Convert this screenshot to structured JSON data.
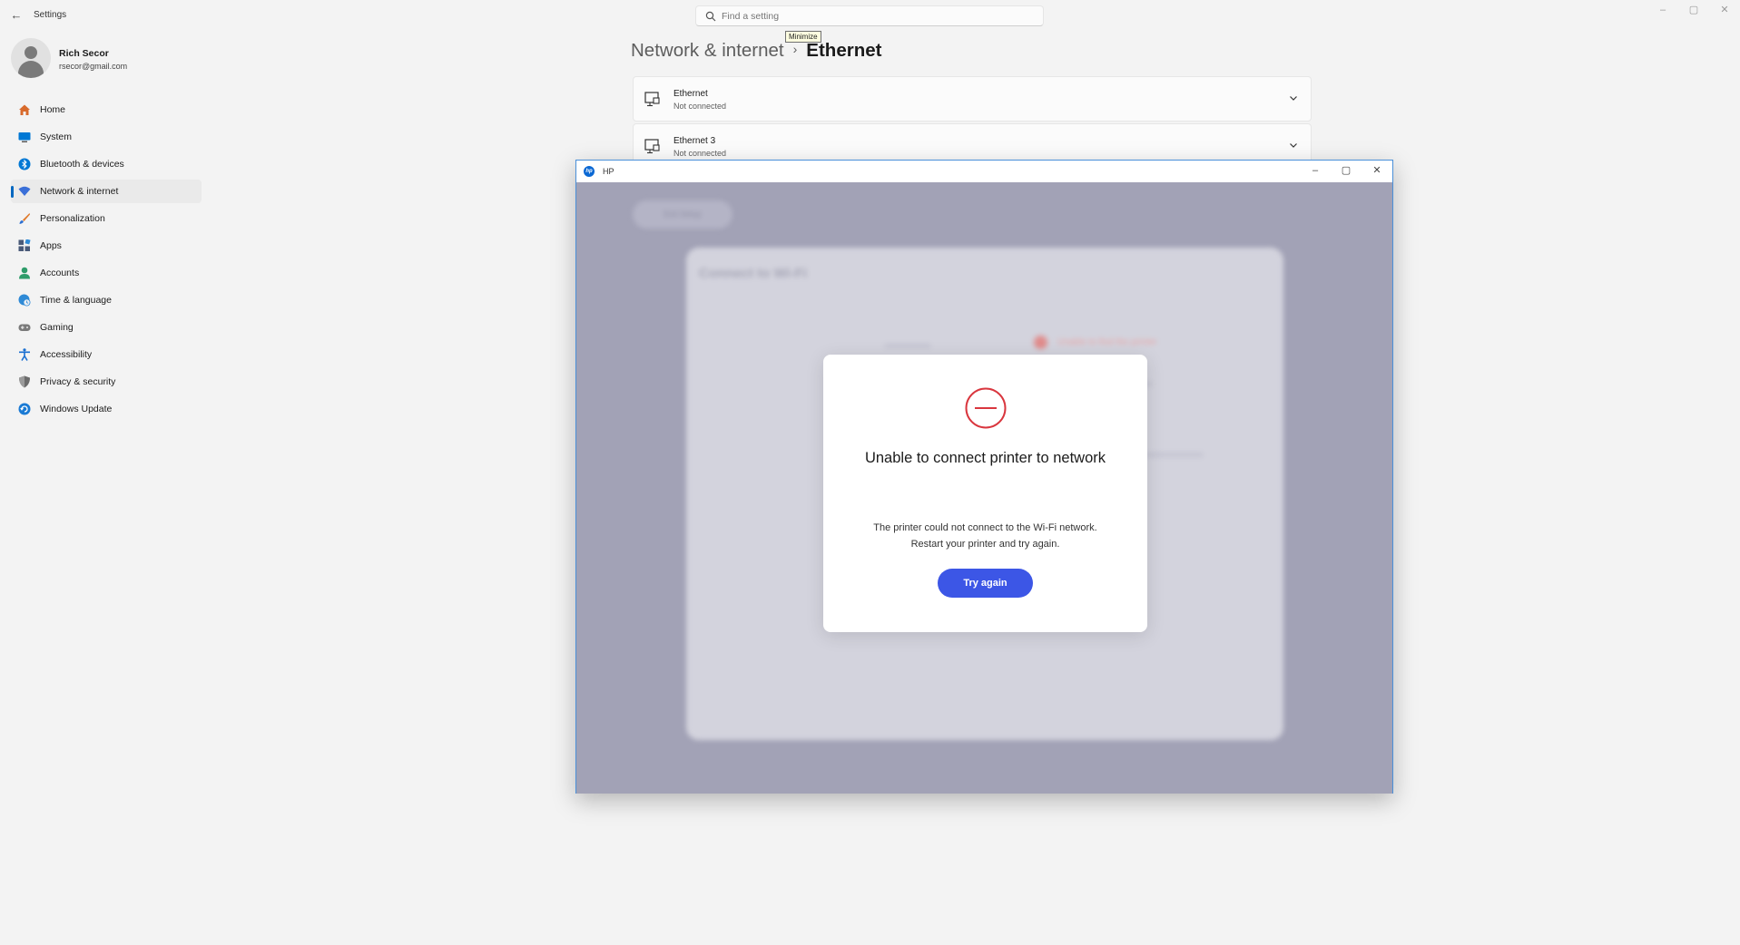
{
  "app": {
    "title": "Settings"
  },
  "window_controls": [
    "–",
    "▢",
    "✕"
  ],
  "search": {
    "placeholder": "Find a setting"
  },
  "user": {
    "name": "Rich Secor",
    "email": "rsecor@gmail.com"
  },
  "sidebar": {
    "items": [
      {
        "label": "Home",
        "icon": "home-icon",
        "color": "#d86a2b"
      },
      {
        "label": "System",
        "icon": "system-icon",
        "color": "#0078d4"
      },
      {
        "label": "Bluetooth & devices",
        "icon": "bluetooth-icon",
        "color": "#0078d4"
      },
      {
        "label": "Network & internet",
        "icon": "network-icon",
        "color": "#3a6fd8",
        "active": true
      },
      {
        "label": "Personalization",
        "icon": "brush-icon",
        "color": "#e07a2c"
      },
      {
        "label": "Apps",
        "icon": "apps-icon",
        "color": "#4a5a78"
      },
      {
        "label": "Accounts",
        "icon": "accounts-icon",
        "color": "#2e9c6a"
      },
      {
        "label": "Time & language",
        "icon": "globe-clock-icon",
        "color": "#2f8ad6"
      },
      {
        "label": "Gaming",
        "icon": "gaming-icon",
        "color": "#7a7a7a"
      },
      {
        "label": "Accessibility",
        "icon": "accessibility-icon",
        "color": "#1a6fd1"
      },
      {
        "label": "Privacy & security",
        "icon": "shield-icon",
        "color": "#6b6b6b"
      },
      {
        "label": "Windows Update",
        "icon": "update-icon",
        "color": "#1a7ad4"
      }
    ]
  },
  "breadcrumb": {
    "parent": "Network & internet",
    "separator": "›",
    "current": "Ethernet"
  },
  "tooltip": {
    "text": "Minimize"
  },
  "adapters": [
    {
      "name": "Ethernet",
      "status": "Not connected"
    },
    {
      "name": "Ethernet 3",
      "status": "Not connected"
    }
  ],
  "hp_window": {
    "title": "HP",
    "controls": [
      "–",
      "▢",
      "✕"
    ],
    "background": {
      "exit_button": "Exit Setup",
      "card_title": "Connect to Wi-Fi",
      "status": "Unable to find the printer"
    },
    "modal": {
      "title": "Unable to connect printer to network",
      "message": "The printer could not connect to the Wi-Fi network. Restart your printer and try again.",
      "button": "Try again",
      "accent": "#3c56e6",
      "error_color": "#d9363e"
    }
  }
}
